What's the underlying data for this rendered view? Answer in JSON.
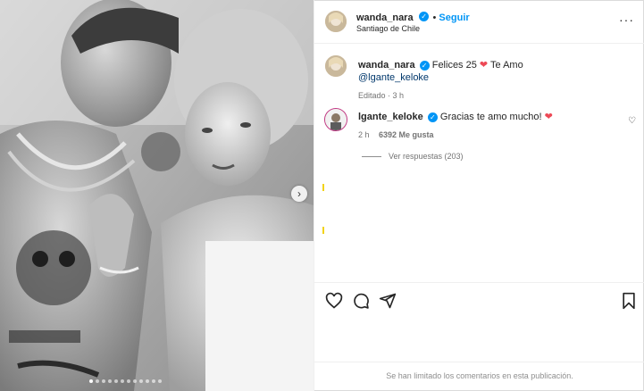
{
  "post": {
    "author": "wanda_nara",
    "follow_label": "Seguir",
    "location": "Santiago de Chile",
    "more_glyph": "···"
  },
  "caption": {
    "author": "wanda_nara",
    "text_before": "Felices 25",
    "text_after": "Te Amo",
    "mention": "@lgante_keloke",
    "edited": "Editado · 3 h"
  },
  "comment": {
    "author": "lgante_keloke",
    "text": "Gracias te amo mucho!",
    "time": "2 h",
    "likes": "6392 Me gusta",
    "replies": "Ver respuestas (203)"
  },
  "footer": {
    "notice": "Se han limitado los comentarios en esta publicación."
  },
  "carousel": {
    "next_glyph": "›",
    "total": 12,
    "active_index": 0
  },
  "colors": {
    "accent": "#0095f6",
    "heart": "#ed4956"
  }
}
